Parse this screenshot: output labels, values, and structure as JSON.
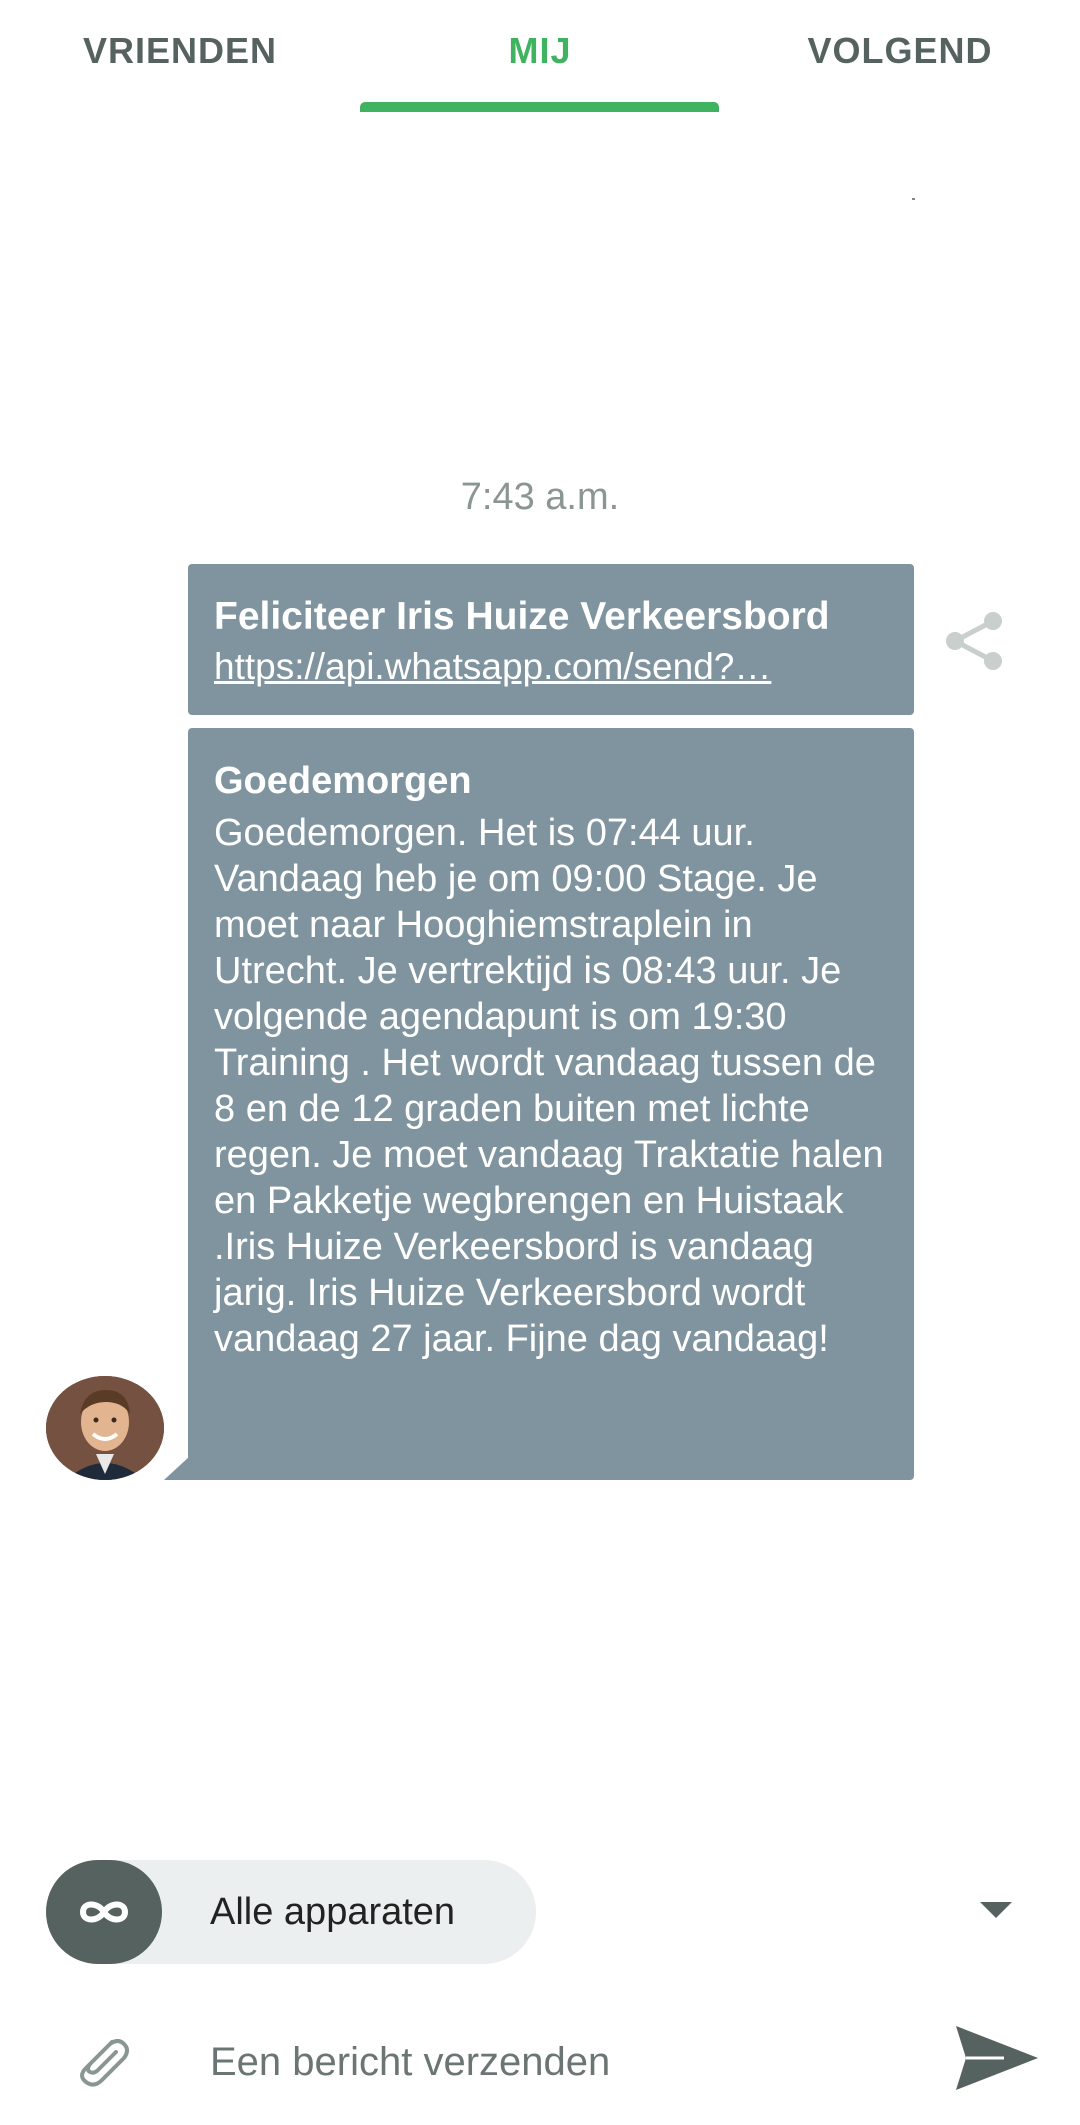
{
  "tabs": [
    {
      "label": "VRIENDEN",
      "active": false
    },
    {
      "label": "MIJ",
      "active": true
    },
    {
      "label": "VOLGEND",
      "active": false
    }
  ],
  "colors": {
    "accent": "#3fb35f",
    "tab_text": "#56625f",
    "bubble": "#7f949e",
    "pill_bg": "#ecefef",
    "icon_dark": "#56625f"
  },
  "chat": {
    "timestamp": "7:43 a.m.",
    "messages": [
      {
        "title": "Feliciteer Iris Huize Verkeersbord",
        "link": "https://api.whatsapp.com/send?…",
        "action_icon": "share-icon"
      },
      {
        "title": "Goedemorgen",
        "body": "Goedemorgen. Het is 07:44 uur. Vandaag heb je om 09:00 Stage. Je moet naar Hooghiemstraplein in Utrecht. Je vertrektijd is 08:43 uur. Je volgende agendapunt is om 19:30 Training . Het wordt vandaag tussen de 8 en de 12 graden buiten met lichte regen. Je moet vandaag Traktatie halen en Pakketje wegbrengen en Huistaak .Iris Huize Verkeersbord is vandaag jarig. Iris Huize Verkeersbord wordt vandaag 27 jaar. Fijne dag vandaag!",
        "sender_avatar": "avatar"
      }
    ]
  },
  "composer": {
    "device_selector": "Alle apparaten",
    "device_icon": "infinity-icon",
    "dropdown_icon": "dropdown-arrow-icon",
    "attach_icon": "paperclip-icon",
    "placeholder": "Een bericht verzenden",
    "value": "",
    "send_icon": "send-icon"
  }
}
